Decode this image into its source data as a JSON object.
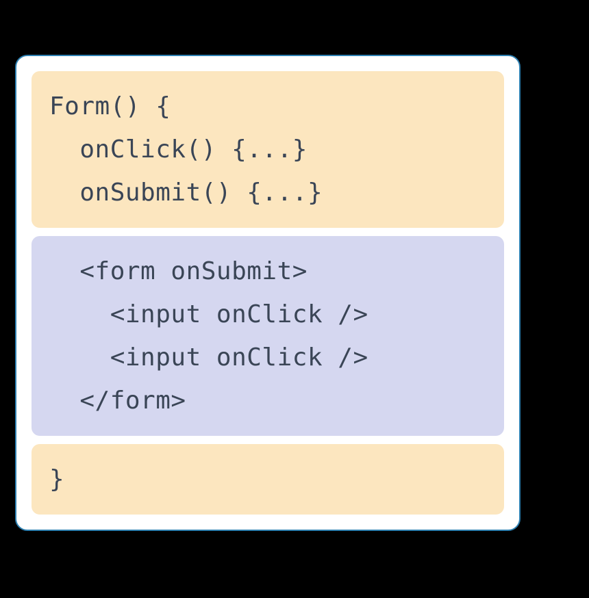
{
  "card": {
    "topBlock": {
      "lines": [
        "Form() {",
        "  onClick() {...}",
        "  onSubmit() {...}"
      ]
    },
    "middleBlock": {
      "lines": [
        "  <form onSubmit>",
        "    <input onClick />",
        "    <input onClick />",
        "  </form>"
      ]
    },
    "bottomBlock": {
      "lines": [
        "}"
      ]
    }
  }
}
